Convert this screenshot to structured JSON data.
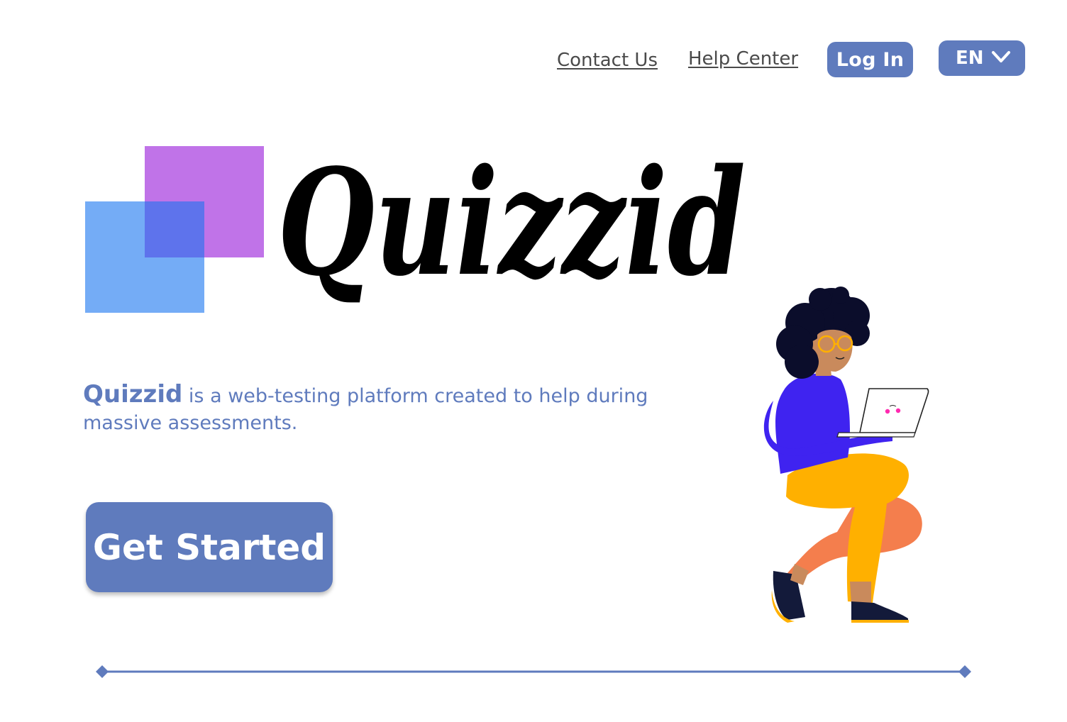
{
  "nav": {
    "contact_label": "Contact Us",
    "help_label": "Help Center",
    "login_label": "Log In",
    "language_label": "EN"
  },
  "logo": {
    "wordmark": "Quizzid",
    "colors": {
      "purple": "#c073e8",
      "blue": "#6ea9f6",
      "overlap": "#5e73ec"
    }
  },
  "hero": {
    "tagline_brand": "Quizzid",
    "tagline_rest": " is a web-testing platform created to help during massive assessments.",
    "cta_label": "Get Started"
  },
  "icons": {
    "language_dropdown": "chevron-down-icon",
    "illustration": "person-with-laptop-illustration"
  },
  "colors": {
    "accent": "#5f7bbd",
    "link": "#4a4a4a"
  }
}
